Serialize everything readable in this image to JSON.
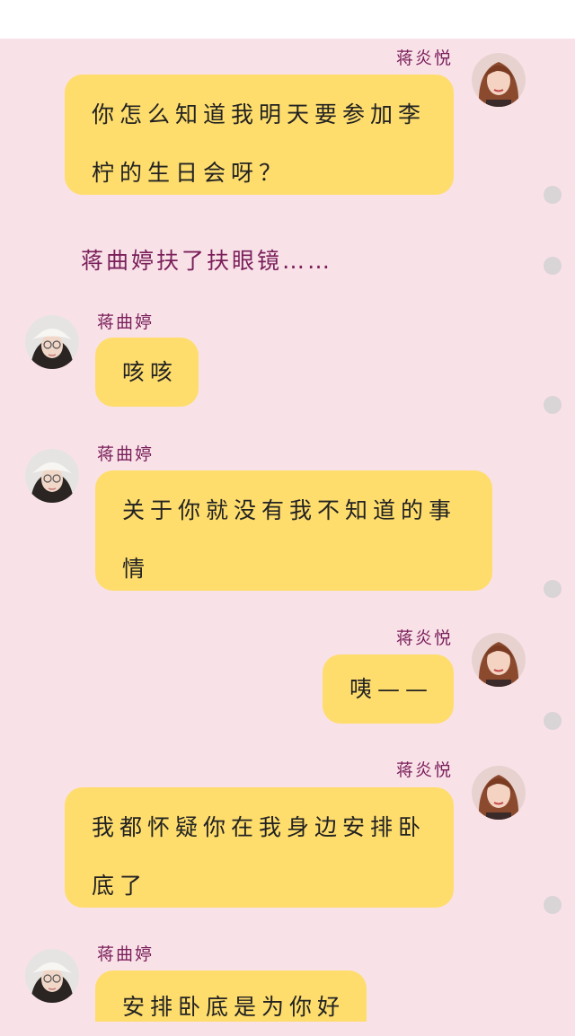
{
  "messages": [
    {
      "side": "right",
      "name": "蒋炎悦",
      "avatar": "avatar-anyan",
      "text": "你怎么知道我明天要参加李柠的生日会呀？"
    },
    {
      "side": "narration",
      "text": "蒋曲婷扶了扶眼镜……"
    },
    {
      "side": "left",
      "name": "蒋曲婷",
      "avatar": "avatar-quting",
      "text": "咳咳"
    },
    {
      "side": "left",
      "name": "蒋曲婷",
      "avatar": "avatar-quting",
      "text": "关于你就没有我不知道的事情"
    },
    {
      "side": "right",
      "name": "蒋炎悦",
      "avatar": "avatar-anyan",
      "text": "咦——"
    },
    {
      "side": "right",
      "name": "蒋炎悦",
      "avatar": "avatar-anyan",
      "text": "我都怀疑你在我身边安排卧底了"
    },
    {
      "side": "left",
      "name": "蒋曲婷",
      "avatar": "avatar-quting",
      "text": "安排卧底是为你好"
    }
  ],
  "colors": {
    "background": "#f9e1e8",
    "bubble": "#fedd6d",
    "name_text": "#7a1f5a",
    "dot": "#d9d4d6"
  }
}
